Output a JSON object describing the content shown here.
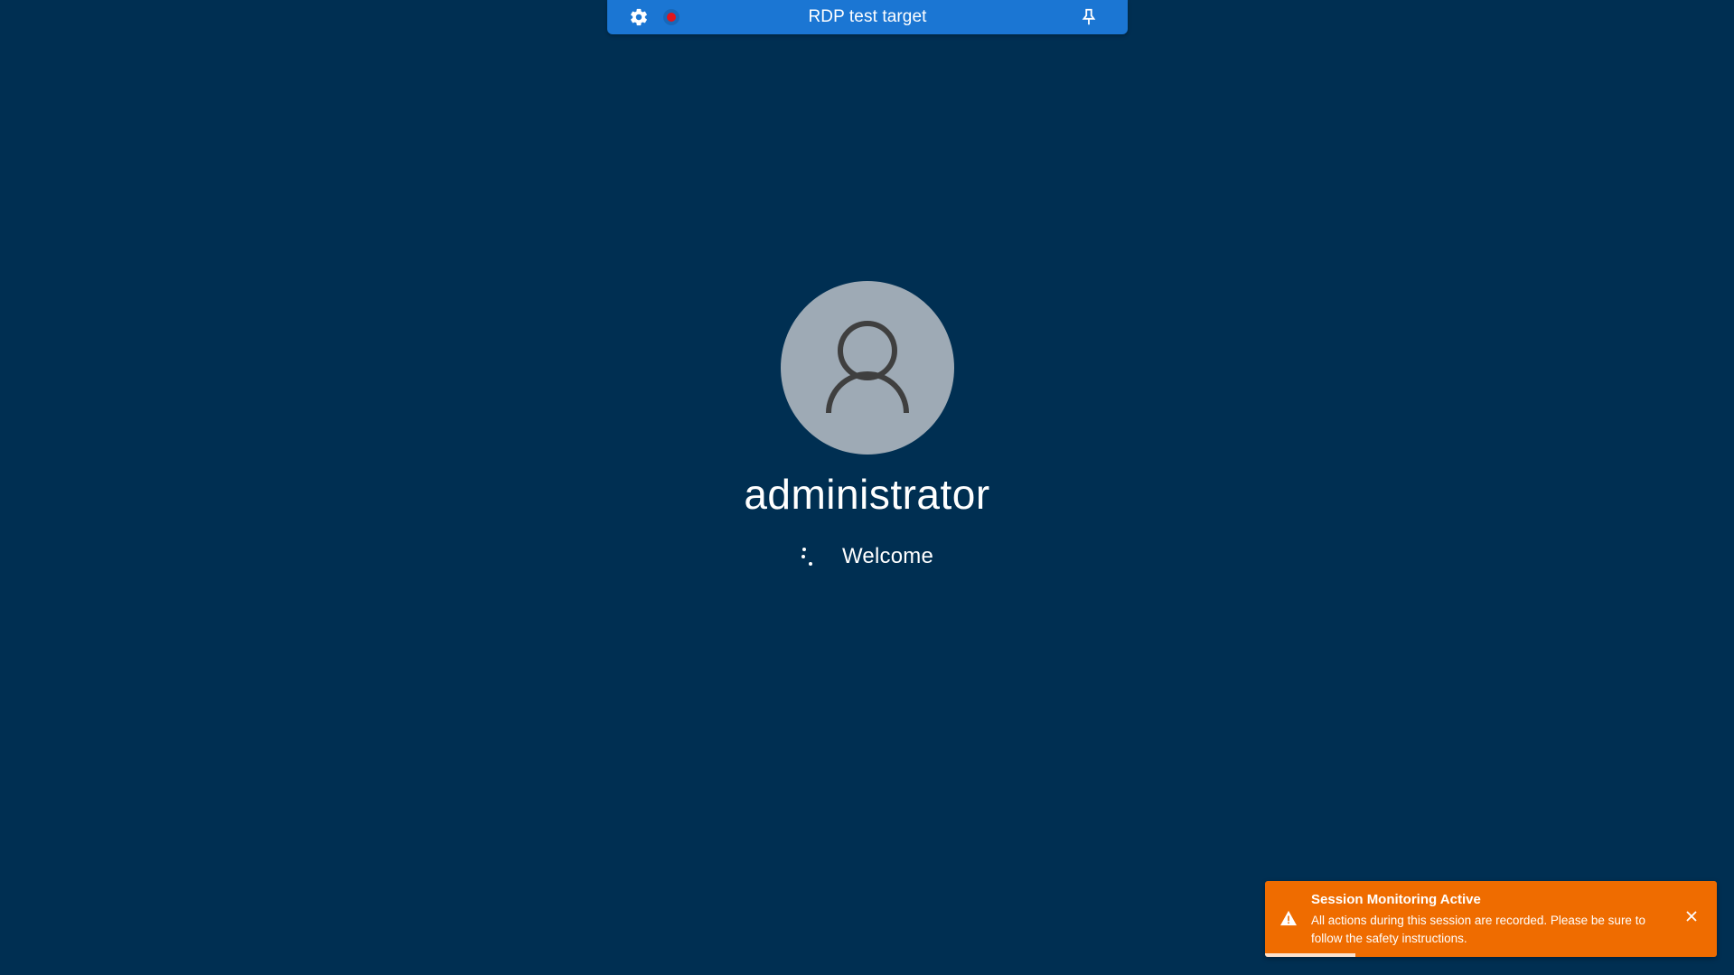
{
  "connection_bar": {
    "title": "RDP test target",
    "settings_icon": "gear-icon",
    "recording_icon": "record-dot-icon",
    "recording_color": "#e0151c",
    "pin_icon": "pin-icon",
    "bar_color": "#1b76d3"
  },
  "login": {
    "avatar_icon": "user-icon",
    "username": "administrator",
    "status": "Welcome",
    "background_color": "#002f52"
  },
  "toast": {
    "icon": "warning-icon",
    "title": "Session Monitoring Active",
    "message": "All actions during this session are recorded. Please be sure to follow the safety instructions.",
    "close_icon": "close-icon",
    "progress": 0.2,
    "color": "#ef6c00"
  }
}
